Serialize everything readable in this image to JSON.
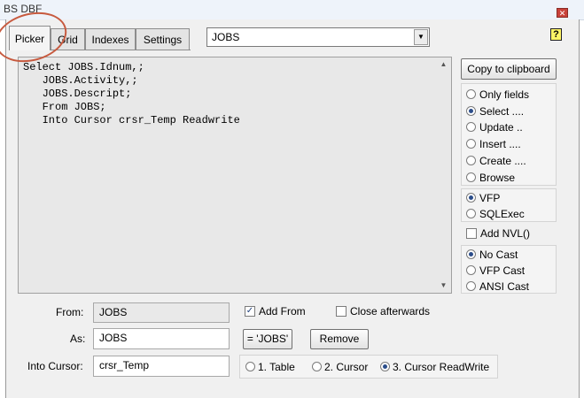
{
  "window": {
    "title": "BS DBF",
    "close_icon": "close-icon"
  },
  "tabs": [
    "Picker",
    "Grid",
    "Indexes",
    "Settings"
  ],
  "table_combo": {
    "value": "JOBS"
  },
  "help_label": "?",
  "sql_lines": [
    "Select JOBS.Idnum,;",
    "   JOBS.Activity,;",
    "   JOBS.Descript;",
    "   From JOBS;",
    "   Into Cursor crsr_Temp Readwrite"
  ],
  "copy_button": "Copy to clipboard",
  "query_type": {
    "options": [
      "Only fields",
      "Select ....",
      "Update ..",
      "Insert ....",
      "Create ....",
      "Browse"
    ],
    "selected": 1
  },
  "dialect": {
    "options": [
      "VFP",
      "SQLExec"
    ],
    "selected": 0
  },
  "add_nvl": {
    "label": "Add NVL()",
    "checked": false
  },
  "cast": {
    "options": [
      "No Cast",
      "VFP Cast",
      "ANSI Cast"
    ],
    "selected": 0
  },
  "form": {
    "from_label": "From:",
    "from_value": "JOBS",
    "as_label": "As:",
    "as_value": "JOBS",
    "into_label": "Into Cursor:",
    "into_value": "crsr_Temp",
    "add_from": {
      "label": "Add From",
      "checked": true
    },
    "close_afterwards": {
      "label": "Close afterwards",
      "checked": false
    },
    "assign_button": "= 'JOBS'",
    "remove_button": "Remove",
    "output": {
      "options": [
        "1. Table",
        "2. Cursor",
        "3. Cursor ReadWrite"
      ],
      "selected": 2
    }
  },
  "colors": {
    "annotation": "#c75a3f",
    "title_bar": "#eef3fa",
    "dialog": "#f0f0f0"
  }
}
